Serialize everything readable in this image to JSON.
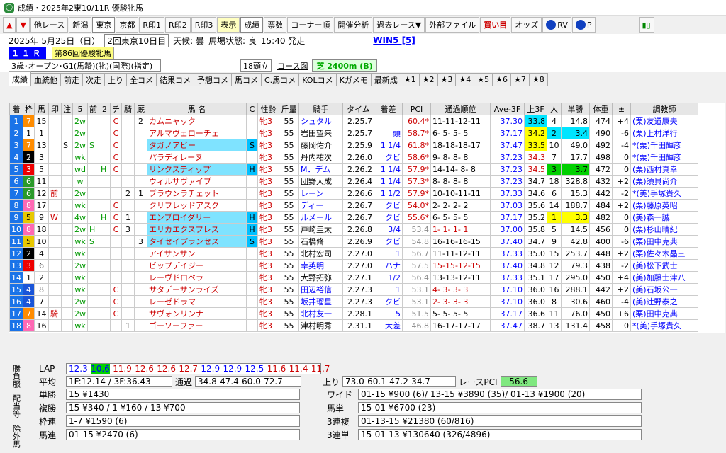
{
  "window": {
    "title": "成績・2025年2東10/11R 優駿牝馬"
  },
  "toolbar": {
    "other_race": "他レース",
    "venues": [
      "新潟",
      "東京",
      "京都"
    ],
    "r": [
      "R印1",
      "R印2",
      "R印3"
    ],
    "display": "表示",
    "result": "成績",
    "votes": "票数",
    "corner": "コーナー順",
    "analysis": "開催分析",
    "past": "過去レース▼",
    "external": "外部ファイル",
    "buy": "買い目",
    "odds": "オッズ",
    "rv": "RV",
    "p": "P"
  },
  "info": {
    "date": "2025年  5月25日（日）",
    "meeting": "2回東京10日目",
    "weather": "天候:  曇",
    "track": "馬場状態:  良",
    "start": "15:40 発走",
    "win5": "WIN5 [5]"
  },
  "race": {
    "num": "１１Ｒ",
    "name": "第86回優駿牝馬",
    "cond": "3歳･オープン･G1(馬齢)(牝)(国際)(指定)",
    "heads": "18頭立",
    "course_label": "コース図",
    "course": "芝 2400m (B)"
  },
  "tabs": [
    "成績",
    "血統他",
    "前走",
    "次走",
    "上り",
    "全コメ",
    "結果コメ",
    "予想コメ",
    "馬コメ",
    "C.馬コメ",
    "KOLコメ",
    "Kガメモ",
    "最新成",
    "★1",
    "★2",
    "★3",
    "★4",
    "★5",
    "★6",
    "★7",
    "★8"
  ],
  "columns": [
    "着",
    "枠",
    "馬",
    "印",
    "注",
    "5",
    "前",
    "2",
    "チ",
    "騎",
    "厩",
    "馬 名",
    "C",
    "性齢",
    "斤量",
    "騎手",
    "タイム",
    "着差",
    "PCI",
    "通過順位",
    "Ave-3F",
    "上3F",
    "人",
    "単勝",
    "体重",
    "±",
    "調教師"
  ],
  "rows": [
    [
      "1",
      "7",
      "15",
      "",
      "",
      "2w",
      "",
      "",
      "C",
      "",
      "2",
      "カムニャック",
      "",
      "牝3",
      "55",
      "シュタル",
      "2.25.7",
      "",
      "60.4*",
      "11-11-12-11",
      "37.30",
      "33.8",
      "4",
      "14.8",
      "474",
      "+4",
      "(栗)友道康夫"
    ],
    [
      "2",
      "1",
      "1",
      "",
      "",
      "2w",
      "",
      "",
      "C",
      "",
      "",
      "アルマヴェローチェ",
      "",
      "牝3",
      "55",
      "岩田望来",
      "2.25.7",
      "頭",
      "58.7*",
      "6- 5- 5- 5",
      "37.17",
      "34.2",
      "2",
      "3.4",
      "490",
      "-6",
      "(栗)上村洋行"
    ],
    [
      "3",
      "7",
      "13",
      "",
      "S",
      "2w",
      "S",
      "",
      "C",
      "",
      "",
      "タガノアビー",
      "S",
      "牝3",
      "55",
      "藤岡佑介",
      "2.25.9",
      "1 1/4",
      "61.8*",
      "18-18-18-17",
      "37.47",
      "33.5",
      "10",
      "49.0",
      "492",
      "-4",
      "*(栗)千田輝彦"
    ],
    [
      "4",
      "2",
      "3",
      "",
      "",
      "wk",
      "",
      "",
      "C",
      "",
      "",
      "パラディレーヌ",
      "",
      "牝3",
      "55",
      "丹内祐次",
      "2.26.0",
      "クビ",
      "58.6*",
      "9- 8- 8- 8",
      "37.23",
      "34.3",
      "7",
      "17.7",
      "498",
      "0",
      "*(栗)千田輝彦"
    ],
    [
      "5",
      "3",
      "5",
      "",
      "",
      "wd",
      "",
      "H",
      "C",
      "",
      "",
      "リンクスティップ",
      "H",
      "牝3",
      "55",
      "M．デム",
      "2.26.2",
      "1 1/4",
      "57.9*",
      "14-14- 8- 8",
      "37.23",
      "34.5",
      "3",
      "3.7",
      "472",
      "0",
      "(栗)西村真幸"
    ],
    [
      "6",
      "6",
      "11",
      "",
      "",
      "w",
      "",
      "",
      "",
      "",
      "",
      "ウィルサヴァイブ",
      "",
      "牝3",
      "55",
      "団野大成",
      "2.26.4",
      "1 1/4",
      "57.3*",
      "8- 8- 8- 8",
      "37.23",
      "34.7",
      "18",
      "328.8",
      "432",
      "+2",
      "(栗)須貝尚介"
    ],
    [
      "7",
      "6",
      "12",
      "前",
      "",
      "2w",
      "",
      "",
      "",
      "2",
      "1",
      "ブラウンラチェット",
      "",
      "牝3",
      "55",
      "レーン",
      "2.26.6",
      "1 1/2",
      "57.9*",
      "10-10-11-11",
      "37.33",
      "34.6",
      "6",
      "15.3",
      "442",
      "-2",
      "*(美)手塚貴久"
    ],
    [
      "8",
      "8",
      "17",
      "",
      "",
      "wk",
      "",
      "",
      "C",
      "",
      "",
      "クリフレッドアスク",
      "",
      "牝3",
      "55",
      "ディー",
      "2.26.7",
      "クビ",
      "54.0*",
      "2- 2- 2- 2",
      "37.03",
      "35.6",
      "14",
      "188.7",
      "484",
      "+2",
      "(栗)藤原英昭"
    ],
    [
      "9",
      "5",
      "9",
      "W",
      "",
      "4w",
      "",
      "H",
      "C",
      "1",
      "",
      "エンブロイダリー",
      "H",
      "牝3",
      "55",
      "ルメール",
      "2.26.7",
      "クビ",
      "55.6*",
      "6- 5- 5- 5",
      "37.17",
      "35.2",
      "1",
      "3.3",
      "482",
      "0",
      "(美)森一誠"
    ],
    [
      "10",
      "8",
      "18",
      "",
      "",
      "2w",
      "H",
      "",
      "C",
      "3",
      "",
      "エリカエクスプレス",
      "H",
      "牝3",
      "55",
      "戸崎圭太",
      "2.26.8",
      "3/4",
      "53.4",
      "1- 1- 1- 1",
      "37.00",
      "35.8",
      "5",
      "14.5",
      "456",
      "0",
      "(栗)杉山晴紀"
    ],
    [
      "11",
      "5",
      "10",
      "",
      "",
      "wk",
      "S",
      "",
      "",
      "",
      "3",
      "タイセイプランセス",
      "S",
      "牝3",
      "55",
      "石橋脩",
      "2.26.9",
      "クビ",
      "54.8",
      "16-16-16-15",
      "37.40",
      "34.7",
      "9",
      "42.8",
      "400",
      "-6",
      "(栗)田中克典"
    ],
    [
      "12",
      "2",
      "4",
      "",
      "",
      "wk",
      "",
      "",
      "",
      "",
      "",
      "アイサンサン",
      "",
      "牝3",
      "55",
      "北村宏司",
      "2.27.0",
      "1",
      "56.7",
      "11-11-12-11",
      "37.33",
      "35.0",
      "15",
      "253.7",
      "448",
      "+2",
      "(栗)佐々木晶三"
    ],
    [
      "13",
      "3",
      "6",
      "",
      "",
      "2w",
      "",
      "",
      "",
      "",
      "",
      "ビップデイジー",
      "",
      "牝3",
      "55",
      "幸英明",
      "2.27.0",
      "ハナ",
      "57.5",
      "15-15-12-15",
      "37.40",
      "34.8",
      "12",
      "79.3",
      "438",
      "-2",
      "(美)松下武士"
    ],
    [
      "14",
      "1",
      "2",
      "",
      "",
      "wk",
      "",
      "",
      "",
      "",
      "",
      "レーヴドロベラ",
      "",
      "牝3",
      "55",
      "大野拓弥",
      "2.27.1",
      "1/2",
      "56.4",
      "13-13-12-11",
      "37.33",
      "35.1",
      "17",
      "295.0",
      "450",
      "+4",
      "(美)加藤士津八"
    ],
    [
      "15",
      "4",
      "8",
      "",
      "",
      "wk",
      "",
      "",
      "C",
      "",
      "",
      "サタデーサンライズ",
      "",
      "牝3",
      "55",
      "田辺裕信",
      "2.27.3",
      "1",
      "53.1",
      "4- 3- 3- 3",
      "37.10",
      "36.0",
      "16",
      "288.1",
      "442",
      "+2",
      "(美)石坂公一"
    ],
    [
      "16",
      "4",
      "7",
      "",
      "",
      "2w",
      "",
      "",
      "C",
      "",
      "",
      "レーゼドラマ",
      "",
      "牝3",
      "55",
      "坂井瑠星",
      "2.27.3",
      "クビ",
      "53.1",
      "2- 3- 3- 3",
      "37.10",
      "36.0",
      "8",
      "30.6",
      "460",
      "-4",
      "(美)辻野泰之"
    ],
    [
      "17",
      "7",
      "14",
      "騎",
      "",
      "2w",
      "",
      "",
      "C",
      "",
      "",
      "サヴォンリンナ",
      "",
      "牝3",
      "55",
      "北村友一",
      "2.28.1",
      "5",
      "51.5",
      "5- 5- 5- 5",
      "37.17",
      "36.6",
      "11",
      "76.0",
      "450",
      "+6",
      "(栗)田中克典"
    ],
    [
      "18",
      "8",
      "16",
      "",
      "",
      "wk",
      "",
      "",
      "",
      "1",
      "",
      "ゴーソーファー",
      "",
      "牝3",
      "55",
      "津村明秀",
      "2.31.1",
      "大差",
      "46.8",
      "16-17-17-17",
      "37.47",
      "38.7",
      "13",
      "131.4",
      "458",
      "0",
      "*(美)手塚貴久"
    ]
  ],
  "bottom": {
    "side": [
      "勝負服",
      "配当等",
      "除外馬"
    ],
    "lap_label": "LAP",
    "laps": [
      "12.3",
      "10.6",
      "11.9",
      "12.6",
      "12.6",
      "12.7",
      "12.9",
      "12.9",
      "12.5",
      "11.6",
      "11.4",
      "11.7"
    ],
    "avg_label": "平均",
    "avg": "1F:12.14 / 3F:36.43",
    "pace_label": "通過",
    "pace": "34.8-47.4-60.0-72.7",
    "agari_label": "上り",
    "agari": "73.0-60.1-47.2-34.7",
    "pci_label": "レースPCI",
    "pci": "56.6",
    "tan_label": "単勝",
    "tan": "15 ¥1430",
    "fuku_label": "複勝",
    "fuku": "15 ¥340 / 1 ¥160 / 13 ¥700",
    "waku_label": "枠連",
    "waku": "1-7 ¥1590 (6)",
    "umaren_label": "馬連",
    "umaren": "01-15 ¥2470 (6)",
    "wide_label": "ワイド",
    "wide": "01-15 ¥900 (6)/ 13-15 ¥3890 (35)/ 01-13 ¥1900 (20)",
    "umatan_label": "馬単",
    "umatan": "15-01 ¥6700 (23)",
    "trio_label": "3連複",
    "trio": "01-13-15 ¥21380 (60/816)",
    "trifecta_label": "3連単",
    "trifecta": "15-01-13 ¥130640 (326/4896)"
  },
  "colors": {
    "gate": [
      "#fff",
      "#000",
      "#e00",
      "#1a55d8",
      "#e8c800",
      "#2a9a2a",
      "#ff8c00",
      "#ff69b4"
    ]
  }
}
